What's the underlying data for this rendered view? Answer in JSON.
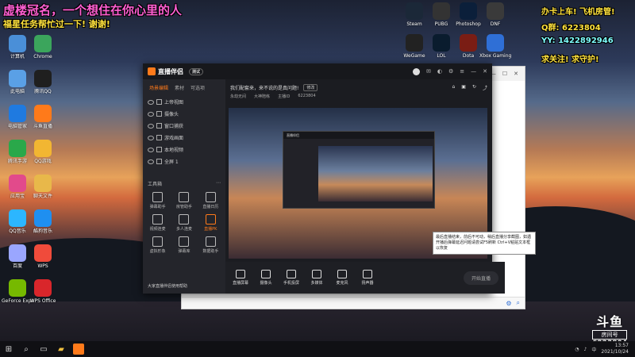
{
  "overlay": {
    "line1": "虚楼冠名，一个想住在你心里的人",
    "line2": "福星任务帮忙过一下! 谢谢!",
    "right_title": "办卡上车! 飞机房管!",
    "qq": "Q群: 6223804",
    "yy": "YY: 1422892946",
    "follow": "求关注! 求守护!"
  },
  "desktop_left_icons": [
    {
      "label": "计算机",
      "icon": "computer-icon",
      "color": "#4a8fd8"
    },
    {
      "label": "Chrome",
      "icon": "chrome-icon",
      "color": "#3ba55c"
    },
    {
      "label": "此电脑",
      "icon": "pc-icon",
      "color": "#5aa0e6"
    },
    {
      "label": "腾讯QQ",
      "icon": "qq-icon",
      "color": "#1f1f1f"
    },
    {
      "label": "电脑管家",
      "icon": "shield-icon",
      "color": "#1f7ae0"
    },
    {
      "label": "斗鱼直播",
      "icon": "douyu-icon",
      "color": "#ff7a1a"
    },
    {
      "label": "腾讯手游",
      "icon": "play-icon",
      "color": "#2aa84a"
    },
    {
      "label": "QQ游戏",
      "icon": "game-icon",
      "color": "#f2b632"
    },
    {
      "label": "应用宝",
      "icon": "store-icon",
      "color": "#e24a8b"
    },
    {
      "label": "聊天文件",
      "icon": "folder-icon",
      "color": "#e8b84a"
    },
    {
      "label": "QQ音乐",
      "icon": "music-icon",
      "color": "#2cb6ff"
    },
    {
      "label": "酷狗音乐",
      "icon": "kugou-icon",
      "color": "#1f8ff0"
    },
    {
      "label": "百度",
      "icon": "baidu-icon",
      "color": "#9aa6ff"
    },
    {
      "label": "WPS",
      "icon": "wps-icon",
      "color": "#f04b3b"
    },
    {
      "label": "GeForce Experience",
      "icon": "nvidia-icon",
      "color": "#76b900"
    },
    {
      "label": "WPS Office",
      "icon": "wps-office-icon",
      "color": "#d9262b"
    }
  ],
  "desktop_top_icons": [
    {
      "label": "Steam",
      "icon": "steam-icon",
      "color": "#1b2838"
    },
    {
      "label": "PUBG",
      "icon": "pubg-icon",
      "color": "#333333"
    },
    {
      "label": "Photoshop",
      "icon": "photoshop-icon",
      "color": "#0b1f3a"
    },
    {
      "label": "DNF",
      "icon": "dnf-icon",
      "color": "#3a3a3a"
    },
    {
      "label": "WeGame",
      "icon": "wegame-icon",
      "color": "#222222"
    },
    {
      "label": "LOL",
      "icon": "lol-icon",
      "color": "#0a1c2e"
    },
    {
      "label": "Dota",
      "icon": "dota-icon",
      "color": "#7a1d14"
    },
    {
      "label": "Xbox Gaming",
      "icon": "xbox-icon",
      "color": "#2f6fd6"
    }
  ],
  "app": {
    "logo": "直播伴侣",
    "version": "测试",
    "left_tabs": [
      "场景编辑",
      "素材",
      "可选项"
    ],
    "scenes": [
      "上帝视图",
      "摄像头",
      "窗口捕获",
      "游戏画面",
      "本地视频",
      "全屏 1"
    ],
    "tools_header": "工具箱",
    "tools": [
      {
        "label": "弹幕助手",
        "hot": false
      },
      {
        "label": "房管助手",
        "hot": false
      },
      {
        "label": "直播日历",
        "hot": false
      },
      {
        "label": "视频连麦",
        "hot": false
      },
      {
        "label": "多人连麦",
        "hot": false
      },
      {
        "label": "直播PK",
        "hot": true
      },
      {
        "label": "虚拟形象",
        "hot": false
      },
      {
        "label": "弹幕库",
        "hot": false
      },
      {
        "label": "数据助手",
        "hot": false
      }
    ],
    "left_tip": "大家直播伴侣使用帮助",
    "room_title": "我们配套来，来不说的是真问题!",
    "room_pill": "修改",
    "info": [
      "永劫无间",
      "大神陪练",
      "主播ID",
      "6223804"
    ],
    "bottom": [
      "直播屏幕",
      "摄像头",
      "手机投屏",
      "多媒体",
      "麦克风",
      "扬声器"
    ],
    "start": "开始直播"
  },
  "tooltip": "最后直播结束，前后不可动，稍后直播分享截图，如遇开播后弹幕延迟问题请尝试F5刷新 Ctrl+V粘贴文本框以恢复",
  "taskbar": {
    "time": "13:57",
    "date": "2021/10/24"
  },
  "watermark": {
    "logo": "斗鱼",
    "room_label": "房间号",
    "room_id": "6223804"
  }
}
